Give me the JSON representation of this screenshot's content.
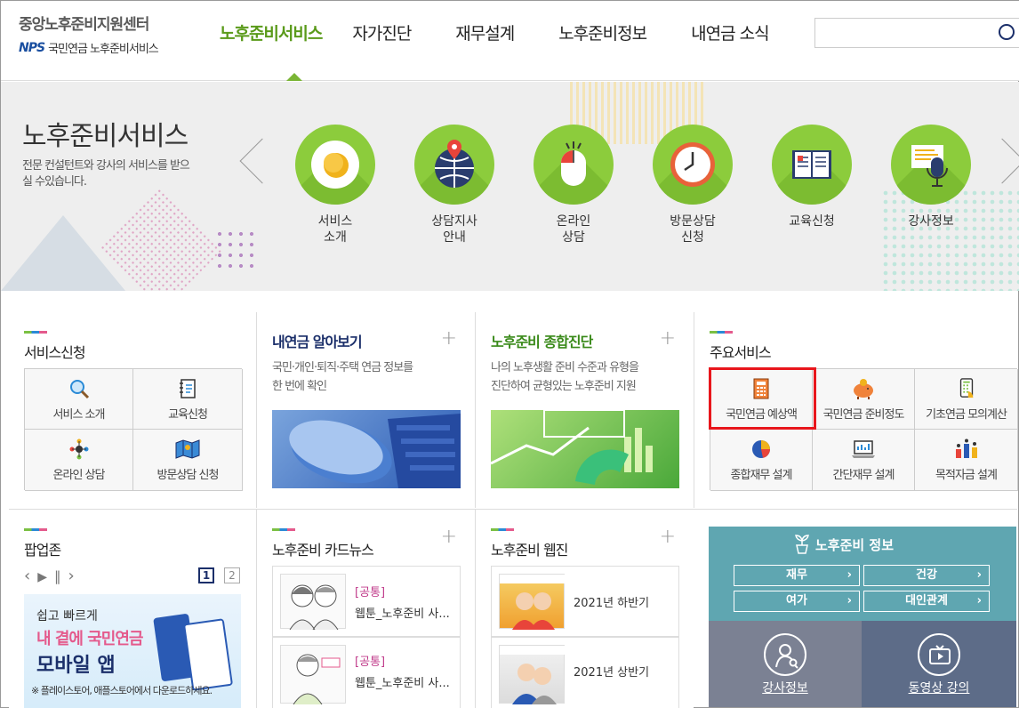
{
  "header": {
    "logo_title": "중앙노후준비지원센터",
    "logo_nps": "NPS",
    "logo_sub": "국민연금 노후준비서비스",
    "nav": [
      "노후준비서비스",
      "자가진단",
      "재무설계",
      "노후준비정보",
      "내연금 소식"
    ],
    "search_placeholder": ""
  },
  "hero": {
    "title": "노후준비서비스",
    "desc": "전문 컨설턴트와 강사의 서비스를 받으실 수있습니다.",
    "services": [
      {
        "label": "서비스\n소개",
        "l1": "서비스",
        "l2": "소개",
        "icon": "egg-icon"
      },
      {
        "label": "상담지사 안내",
        "l1": "상담지사",
        "l2": "안내",
        "icon": "globe-pin-icon"
      },
      {
        "label": "온라인 상담",
        "l1": "온라인",
        "l2": "상담",
        "icon": "mouse-icon"
      },
      {
        "label": "방문상담 신청",
        "l1": "방문상담",
        "l2": "신청",
        "icon": "clock-icon"
      },
      {
        "label": "교육신청",
        "l1": "교육신청",
        "l2": "",
        "icon": "book-icon"
      },
      {
        "label": "강사정보",
        "l1": "강사정보",
        "l2": "",
        "icon": "microphone-icon"
      }
    ]
  },
  "service_apply": {
    "title": "서비스신청",
    "items": [
      "서비스 소개",
      "교육신청",
      "온라인 상담",
      "방문상담 신청"
    ]
  },
  "my_pension": {
    "title": "내연금 알아보기",
    "desc1": "국민·개인·퇴직·주택 연금 정보를",
    "desc2": "한 번에 확인"
  },
  "diagnosis": {
    "title": "노후준비 종합진단",
    "desc1": "나의 노후생활 준비 수준과 유형을",
    "desc2": "진단하여 균형있는 노후준비 지원"
  },
  "main_services": {
    "title": "주요서비스",
    "items": [
      "국민연금 예상액",
      "국민연금 준비정도",
      "기초연금 모의계산",
      "종합재무 설계",
      "간단재무 설계",
      "목적자금 설계"
    ]
  },
  "popup": {
    "title": "팝업존",
    "page1": "1",
    "page2": "2",
    "banner_l1": "쉽고 빠르게",
    "banner_l2": "내 곁에 국민연금",
    "banner_l3": "모바일 앱",
    "banner_note": "※ 플레이스토어, 애플스토어에서 다운로드하세요."
  },
  "cardnews": {
    "title": "노후준비 카드뉴스",
    "items": [
      {
        "tag": "[공통]",
        "text": "웹툰_노후준비 사..."
      },
      {
        "tag": "[공통]",
        "text": "웹툰_노후준비 사..."
      }
    ]
  },
  "webzine": {
    "title": "노후준비 웹진",
    "items": [
      "2021년 하반기",
      "2021년 상반기"
    ]
  },
  "info": {
    "title": "노후준비 정보",
    "buttons": [
      "재무",
      "건강",
      "여가",
      "대인관계"
    ],
    "lecturer": "강사정보",
    "video": "동영상 강의"
  },
  "colors": {
    "accent_green": "#5a9a1a",
    "circle_green": "#8ccc3c",
    "highlight_red": "#e8161c",
    "info_teal": "#5fa6b1"
  }
}
